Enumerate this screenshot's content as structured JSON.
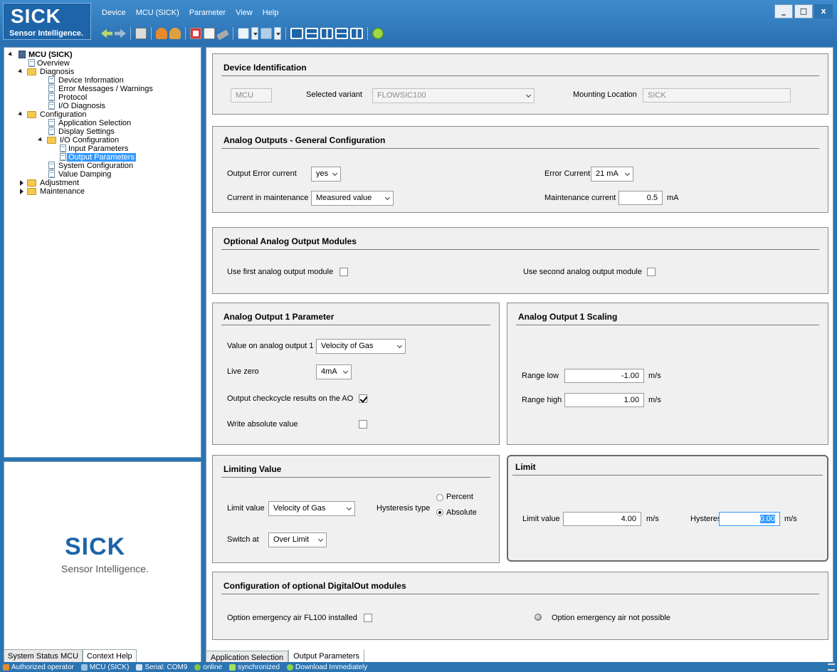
{
  "logo": {
    "brand": "SICK",
    "tagline": "Sensor Intelligence."
  },
  "menu": [
    "Device",
    "MCU (SICK)",
    "Parameter",
    "View",
    "Help"
  ],
  "toolbar_icons": [
    "back-arrow-icon",
    "forward-arrow-icon",
    "print-icon",
    "user-icon",
    "users-icon",
    "pdf-icon",
    "clipboard-icon",
    "eraser-icon",
    "undo-icon",
    "redo-icon",
    "layout-icon",
    "help-icon"
  ],
  "window_controls": {
    "minimize": "_",
    "maximize": "□",
    "close": "x"
  },
  "tree": {
    "root": "MCU (SICK)",
    "overview": "Overview",
    "diagnosis": "Diagnosis",
    "device_information": "Device Information",
    "error_messages": "Error Messages / Warnings",
    "protocol": "Protocol",
    "io_diagnosis": "I/O Diagnosis",
    "configuration": "Configuration",
    "application_selection": "Application Selection",
    "display_settings": "Display Settings",
    "io_configuration": "I/O Configuration",
    "input_parameters": "Input Parameters",
    "output_parameters": "Output Parameters",
    "system_configuration": "System Configuration",
    "value_damping": "Value Damping",
    "adjustment": "Adjustment",
    "maintenance": "Maintenance"
  },
  "left_tabs": {
    "status": "System Status MCU",
    "help": "Context Help"
  },
  "device_id": {
    "title": "Device Identification",
    "device_value": "MCU",
    "variant_label": "Selected variant",
    "variant_value": "FLOWSIC100",
    "mounting_label": "Mounting Location",
    "mounting_value": "SICK"
  },
  "analog_general": {
    "title": "Analog Outputs - General Configuration",
    "output_error_label": "Output Error current",
    "output_error_value": "yes",
    "error_current_label": "Error Current",
    "error_current_value": "21 mA",
    "current_maint_label": "Current in maintenance",
    "current_maint_value": "Measured value",
    "maint_current_label": "Maintenance current",
    "maint_current_value": "0.5",
    "maint_current_unit": "mA"
  },
  "optional_modules": {
    "title": "Optional Analog Output Modules",
    "first_label": "Use first analog output module",
    "second_label": "Use second analog output module"
  },
  "ao1_param": {
    "title": "Analog Output 1 Parameter",
    "value_label": "Value on analog output 1",
    "value_value": "Velocity of Gas",
    "live_zero_label": "Live zero",
    "live_zero_value": "4mA",
    "checkcycle_label": "Output checkcycle results on the AO",
    "absolute_label": "Write absolute value"
  },
  "ao1_scaling": {
    "title": "Analog Output 1 Scaling",
    "range_low_label": "Range low",
    "range_low_value": "-1.00",
    "range_high_label": "Range high",
    "range_high_value": "1.00",
    "unit": "m/s"
  },
  "limiting": {
    "title": "Limiting Value",
    "limit_value_label": "Limit value",
    "limit_value_value": "Velocity of Gas",
    "hysteresis_type_label": "Hysteresis type",
    "percent_label": "Percent",
    "absolute_label": "Absolute",
    "switch_at_label": "Switch at",
    "switch_at_value": "Over Limit"
  },
  "limit": {
    "title": "Limit",
    "limit_value_label": "Limit value",
    "limit_value_value": "4.00",
    "hysteresis_label": "Hysteresis",
    "hysteresis_value": "0.00",
    "unit": "m/s"
  },
  "digital_out": {
    "title": "Configuration of optional DigitalOut modules",
    "emergency_label": "Option emergency air FL100 installed",
    "not_possible_label": "Option emergency air not possible"
  },
  "bottom_tabs": {
    "app_selection": "Application Selection",
    "output_params": "Output Parameters"
  },
  "status": {
    "operator": "Authorized operator",
    "device": "MCU (SICK)",
    "serial": "Serial: COM9",
    "online": "online",
    "sync": "synchronized",
    "download": "Download Immediately"
  },
  "colors": {
    "accent": "#2b74b2",
    "selection": "#3399ff",
    "panel": "#f0f0f0"
  }
}
